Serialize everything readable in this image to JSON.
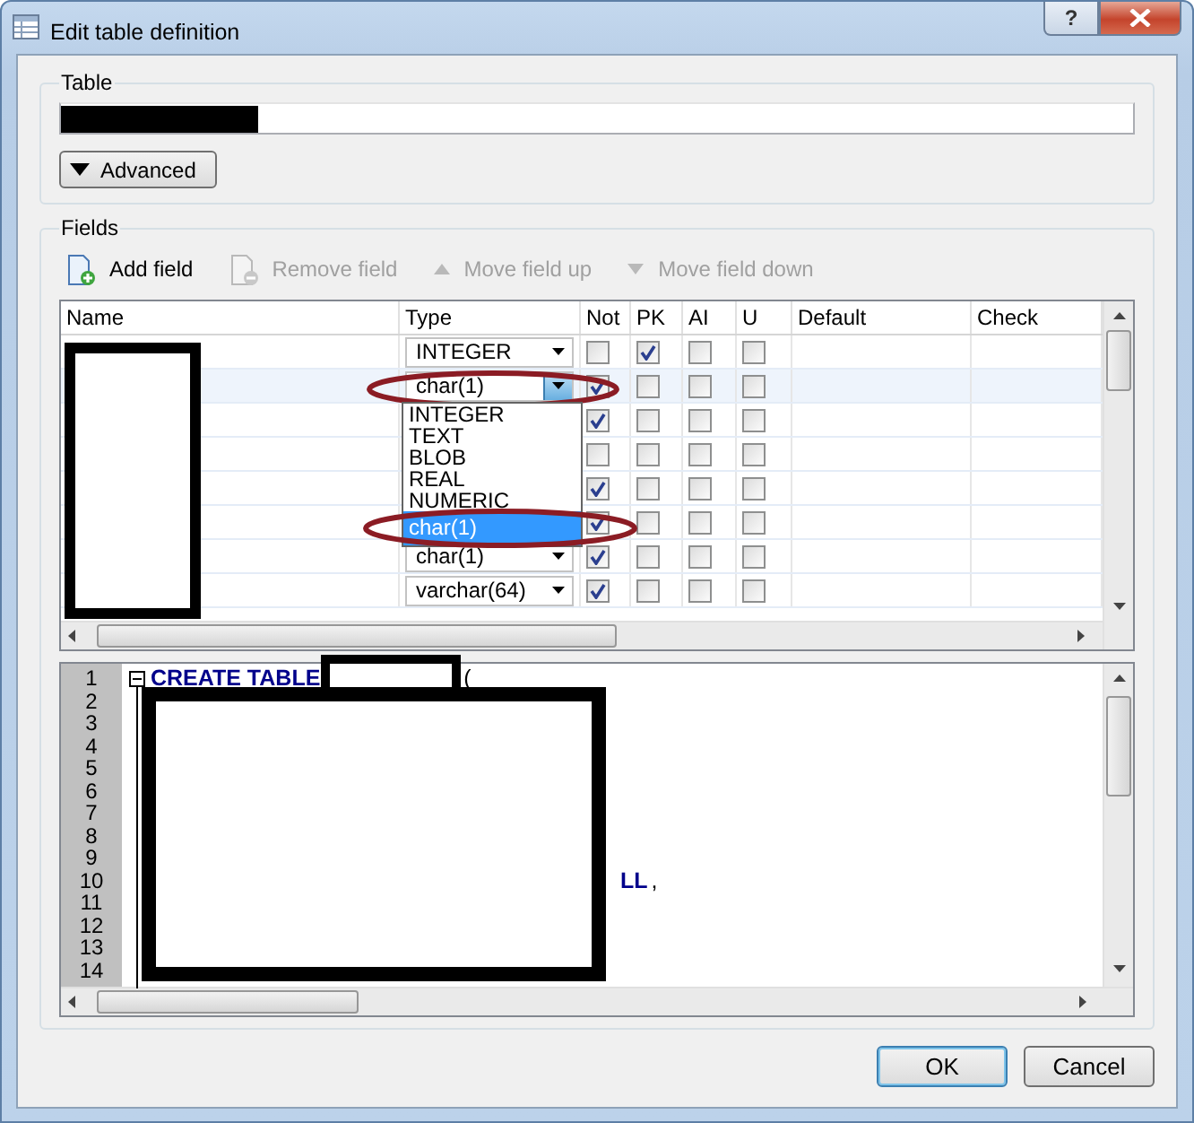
{
  "window": {
    "title": "Edit table definition",
    "help_button": "?"
  },
  "table_group": {
    "title": "Table",
    "value_redacted": true,
    "advanced_button": "Advanced"
  },
  "fields_group": {
    "title": "Fields",
    "toolbar": [
      {
        "kind": "add",
        "label": "Add field",
        "disabled": false
      },
      {
        "kind": "remove",
        "label": "Remove field",
        "disabled": true
      },
      {
        "kind": "up",
        "label": "Move field up",
        "disabled": true
      },
      {
        "kind": "down",
        "label": "Move field down",
        "disabled": true
      }
    ],
    "grid": {
      "columns": [
        "Name",
        "Type",
        "Not",
        "PK",
        "AI",
        "U",
        "Default",
        "Check"
      ],
      "names_redacted": true,
      "rows": [
        {
          "type": "INTEGER",
          "open": false,
          "selected": false,
          "circled": false,
          "not_null": false,
          "primary_key": true,
          "autoincrement": false,
          "unique": false
        },
        {
          "type": "char(1)",
          "open": true,
          "selected": true,
          "circled": true,
          "not_null": true,
          "primary_key": false,
          "autoincrement": false,
          "unique": false
        },
        {
          "selected": false,
          "not_null": true,
          "primary_key": false,
          "autoincrement": false,
          "unique": false
        },
        {
          "selected": false,
          "not_null": false,
          "primary_key": false,
          "autoincrement": false,
          "unique": false
        },
        {
          "selected": false,
          "not_null": true,
          "primary_key": false,
          "autoincrement": false,
          "unique": false
        },
        {
          "selected": false,
          "not_null": true,
          "primary_key": false,
          "autoincrement": false,
          "unique": false
        },
        {
          "type": "char(1)",
          "open": false,
          "selected": false,
          "circled": false,
          "not_null": true,
          "primary_key": false,
          "autoincrement": false,
          "unique": false
        },
        {
          "type": "varchar(64)",
          "open": false,
          "selected": false,
          "circled": false,
          "not_null": true,
          "primary_key": false,
          "autoincrement": false,
          "unique": false
        }
      ],
      "dropdown": [
        {
          "label": "INTEGER",
          "selected": false,
          "circled": false
        },
        {
          "label": "TEXT",
          "selected": false,
          "circled": false
        },
        {
          "label": "BLOB",
          "selected": false,
          "circled": false
        },
        {
          "label": "REAL",
          "selected": false,
          "circled": false
        },
        {
          "label": "NUMERIC",
          "selected": false,
          "circled": false
        },
        {
          "label": "char(1)",
          "selected": true,
          "circled": true
        }
      ]
    },
    "sql_editor": {
      "redaction_block": true,
      "lines": [
        {
          "number": "1",
          "segments": [
            {
              "kind": "keyword",
              "text": "CREATE TABLE"
            },
            {
              "kind": "redacted"
            },
            {
              "kind": "plain",
              "text": "("
            }
          ]
        },
        {
          "number": "2"
        },
        {
          "number": "3"
        },
        {
          "number": "4"
        },
        {
          "number": "5"
        },
        {
          "number": "6"
        },
        {
          "number": "7"
        },
        {
          "number": "8"
        },
        {
          "number": "9"
        },
        {
          "number": "10",
          "segments": [
            {
              "kind": "covered"
            },
            {
              "kind": "keyword",
              "text": "LL"
            },
            {
              "kind": "plain",
              "text": ","
            }
          ]
        },
        {
          "number": "11"
        },
        {
          "number": "12"
        },
        {
          "number": "13"
        },
        {
          "number": "14"
        }
      ]
    }
  },
  "buttons": [
    {
      "label": "OK",
      "default": true
    },
    {
      "label": "Cancel",
      "default": false
    }
  ]
}
